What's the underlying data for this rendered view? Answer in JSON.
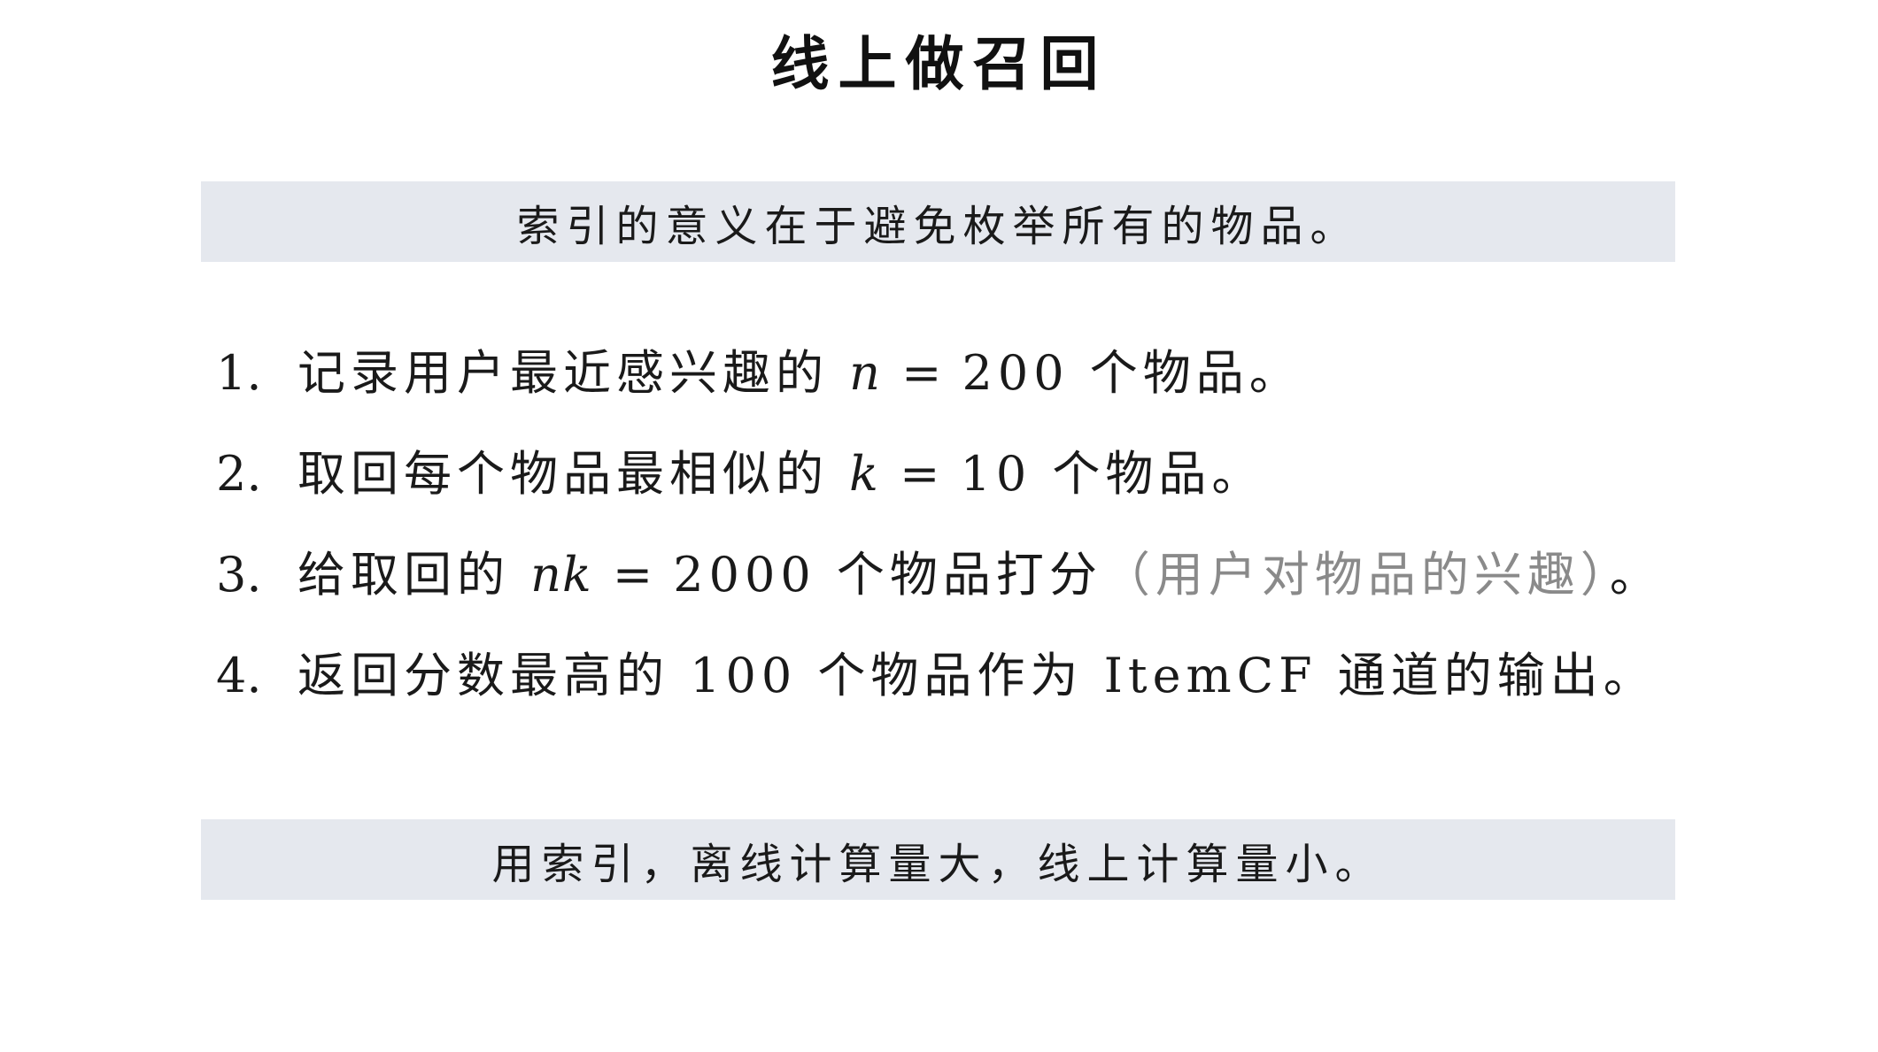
{
  "title": "线上做召回",
  "banner_top": "索引的意义在于避免枚举所有的物品。",
  "banner_bottom": "用索引，离线计算量大，线上计算量小。",
  "steps": [
    {
      "number": "1.",
      "before": "记录用户最近感兴趣的 ",
      "var": "n",
      "op": " = ",
      "value": "200",
      "after": " 个物品。",
      "note": "",
      "end": ""
    },
    {
      "number": "2.",
      "before": "取回每个物品最相似的 ",
      "var": "k",
      "op": " = ",
      "value": "10",
      "after": " 个物品。",
      "note": "",
      "end": ""
    },
    {
      "number": "3.",
      "before": "给取回的 ",
      "var": "nk",
      "op": " = ",
      "value": "2000",
      "after": " 个物品打分",
      "note": "（用户对物品的兴趣）",
      "end": "。"
    },
    {
      "number": "4.",
      "before": "返回分数最高的 100 个物品作为 ItemCF 通道的输出。",
      "var": "",
      "op": "",
      "value": "",
      "after": "",
      "note": "",
      "end": ""
    }
  ]
}
